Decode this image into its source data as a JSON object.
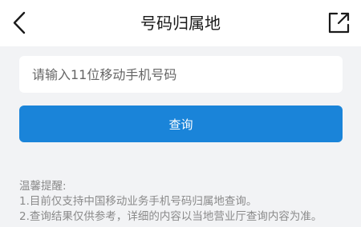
{
  "header": {
    "title": "号码归属地",
    "back_icon": "chevron-left-icon",
    "share_icon": "share-external-icon"
  },
  "form": {
    "phone_placeholder": "请输入11位移动手机号码",
    "phone_value": "",
    "query_label": "查询"
  },
  "tips": {
    "title": "温馨提醒:",
    "items": [
      "1.目前仅支持中国移动业务手机号码归属地查询。",
      "2.查询结果仅供参考，详细的内容以当地营业厅查询内容为准。"
    ]
  },
  "colors": {
    "accent": "#1a84d9",
    "background": "#f2f3f5",
    "tip_text": "#8a8a8a"
  }
}
